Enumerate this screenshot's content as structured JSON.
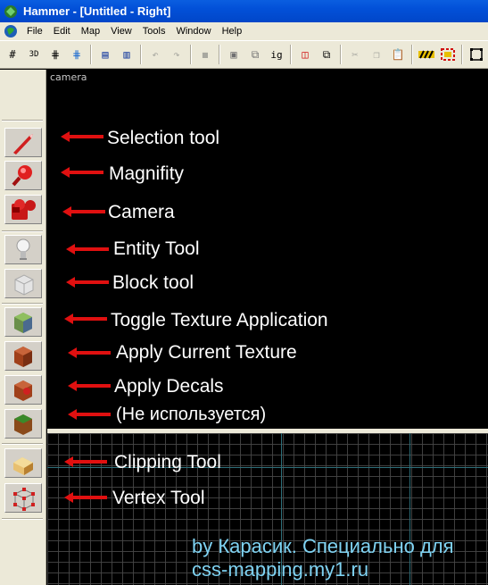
{
  "window": {
    "title": "Hammer - [Untitled - Right]"
  },
  "menu": {
    "items": [
      "File",
      "Edit",
      "Map",
      "View",
      "Tools",
      "Window",
      "Help"
    ]
  },
  "toolbar": {
    "buttons": [
      "grid-icon",
      "3d-grid-icon",
      "grid-toggle-icon",
      "grid-points-icon",
      "group-icon",
      "ungroup-icon",
      "undo-icon",
      "redo-icon",
      "carve-icon",
      "hide-icon",
      "unhide-icon",
      "ignore-group-label",
      "cut-icon",
      "copy-icon",
      "paste-icon",
      "texture-lock-icon",
      "texture-lock-scale-icon",
      "toggle-box-icon"
    ],
    "ignore_label": "ig"
  },
  "viewports": {
    "top_label": "camera"
  },
  "annotations": {
    "selection": "Selection tool",
    "magnify": "Magnifity",
    "camera": "Camera",
    "entity": "Entity Tool",
    "block": "Block tool",
    "toggle_texture": "Toggle Texture Application",
    "apply_texture": "Apply Current Texture",
    "apply_decals": "Apply Decals",
    "unused": "(Не используется)",
    "clipping": "Clipping Tool",
    "vertex": "Vertex Tool"
  },
  "credit": {
    "line1": "by Карасик. Специально для",
    "line2": "css-mapping.my1.ru"
  },
  "colors": {
    "arrow": "#e01010",
    "credit": "#7fd3f3",
    "titlebar": "#0250d8"
  }
}
